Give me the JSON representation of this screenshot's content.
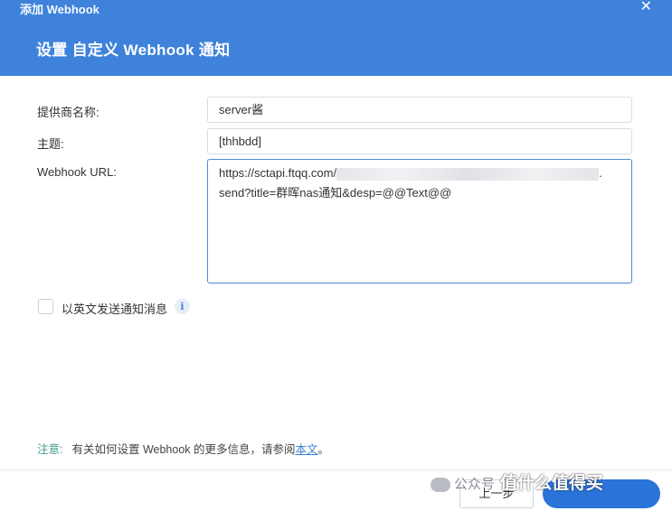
{
  "window": {
    "title": "添加 Webhook",
    "close_glyph": "✕"
  },
  "dialog": {
    "heading": "设置 自定义 Webhook 通知"
  },
  "form": {
    "provider": {
      "label": "提供商名称:",
      "value": "server酱"
    },
    "subject": {
      "label": "主题:",
      "value": "[thhbdd]"
    },
    "url": {
      "label": "Webhook URL:",
      "line1": "https://sctapi.ftqq.com/",
      "line1_end": ".",
      "line2": "send?title=群晖nas通知&desp=@@Text@@"
    },
    "english_checkbox": {
      "label": "以英文发送通知消息",
      "checked": false
    }
  },
  "note": {
    "label": "注意:",
    "text": "有关如何设置 Webhook 的更多信息，请参阅",
    "link": "本文",
    "end": "。"
  },
  "footer": {
    "prev_label": "上一步"
  },
  "watermark": {
    "source": "公众号",
    "brand": "值什么值得买"
  },
  "colors": {
    "header": "#3e82db",
    "link": "#3e82db",
    "note_label": "#3a9b8e"
  }
}
